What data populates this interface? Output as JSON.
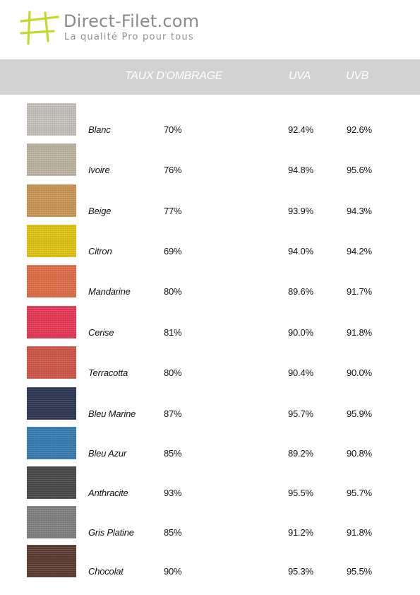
{
  "logo": {
    "brand": "Direct-Filet.com",
    "tagline": "La qualité Pro pour tous",
    "color": "#c5d82f"
  },
  "header": {
    "shade_label": "TAUX D'OMBRAGE",
    "uva_label": "UVA",
    "uvb_label": "UVB",
    "background": "#d2d2d2"
  },
  "rows": [
    {
      "name": "Blanc",
      "shade": "70%",
      "uva": "92.4%",
      "uvb": "92.6%",
      "color": "#c9c6c1"
    },
    {
      "name": "Ivoire",
      "shade": "76%",
      "uva": "94.8%",
      "uvb": "95.6%",
      "color": "#c2b7a5"
    },
    {
      "name": "Beige",
      "shade": "77%",
      "uva": "93.9%",
      "uvb": "94.3%",
      "color": "#d09a5a"
    },
    {
      "name": "Citron",
      "shade": "69%",
      "uva": "94.0%",
      "uvb": "94.2%",
      "color": "#e3c816"
    },
    {
      "name": "Mandarine",
      "shade": "80%",
      "uva": "89.6%",
      "uvb": "91.7%",
      "color": "#e3704a"
    },
    {
      "name": "Cerise",
      "shade": "81%",
      "uva": "90.0%",
      "uvb": "91.8%",
      "color": "#ec3a56"
    },
    {
      "name": "Terracotta",
      "shade": "80%",
      "uva": "90.4%",
      "uvb": "90.0%",
      "color": "#d3594b"
    },
    {
      "name": "Bleu Marine",
      "shade": "87%",
      "uva": "95.7%",
      "uvb": "95.9%",
      "color": "#303a57"
    },
    {
      "name": "Bleu Azur",
      "shade": "85%",
      "uva": "89.2%",
      "uvb": "90.8%",
      "color": "#3a7fb6"
    },
    {
      "name": "Anthracite",
      "shade": "93%",
      "uva": "95.5%",
      "uvb": "95.7%",
      "color": "#4b4b4b"
    },
    {
      "name": "Gris Platine",
      "shade": "85%",
      "uva": "91.2%",
      "uvb": "91.8%",
      "color": "#848484"
    },
    {
      "name": "Chocolat",
      "shade": "90%",
      "uva": "95.3%",
      "uvb": "95.5%",
      "color": "#5e3e33"
    }
  ]
}
